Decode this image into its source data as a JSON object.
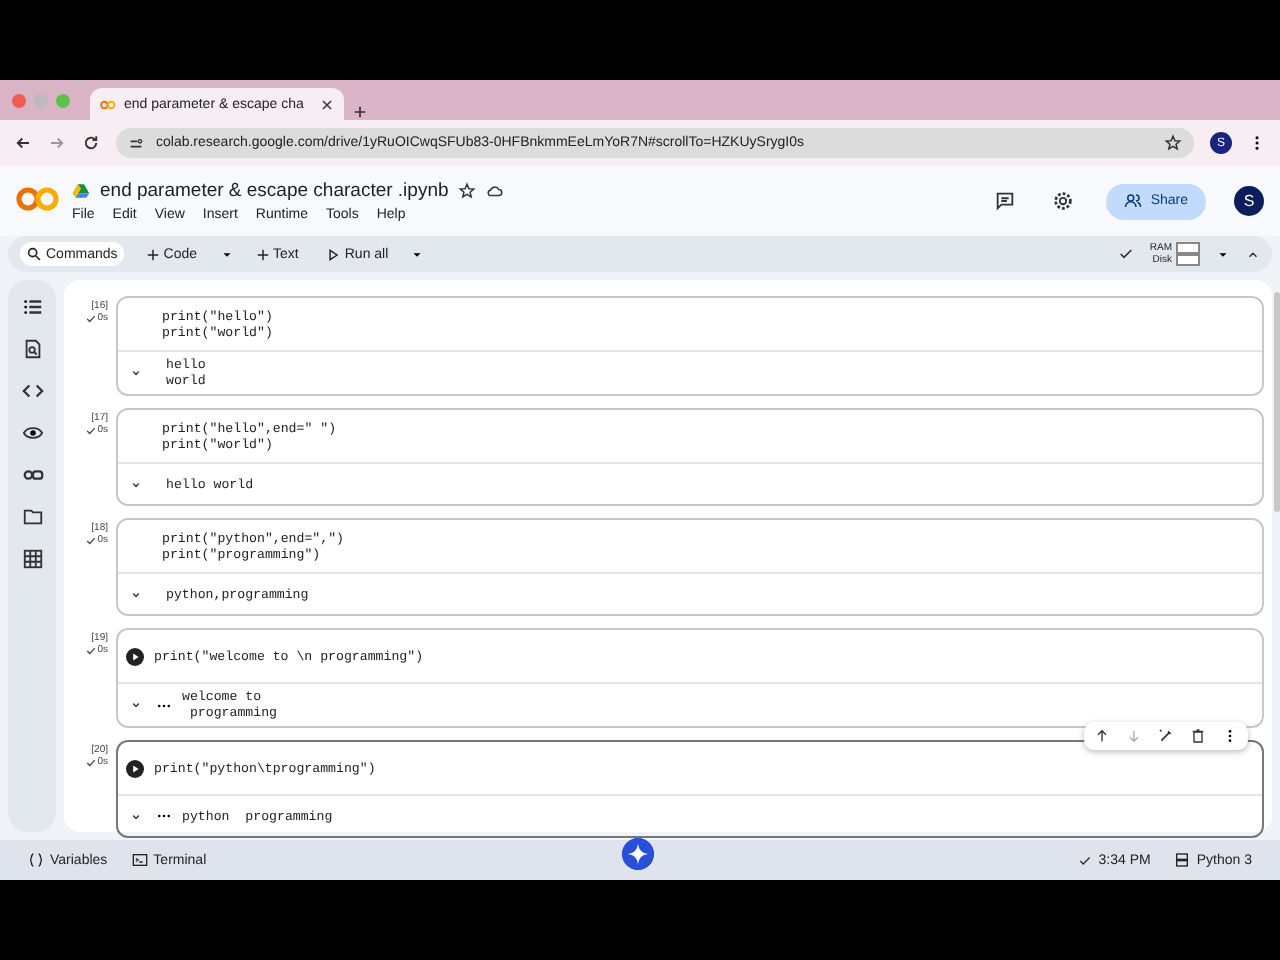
{
  "browser": {
    "tab_title": "end parameter & escape cha",
    "url": "colab.research.google.com/drive/1yRuOICwqSFUb83-0HFBnkmmEeLmYoR7N#scrollTo=HZKUySrygI0s",
    "profile": "S"
  },
  "notebook": {
    "title": "end parameter & escape character .ipynb",
    "menu": [
      "File",
      "Edit",
      "View",
      "Insert",
      "Runtime",
      "Tools",
      "Help"
    ],
    "share": "Share",
    "avatar": "S"
  },
  "toolbar": {
    "commands": "Commands",
    "code": "Code",
    "text": "Text",
    "run_all": "Run all",
    "ram": "RAM",
    "disk": "Disk"
  },
  "cells": [
    {
      "number": "[16]",
      "time": "0s",
      "hovered": false,
      "selected": false,
      "code": [
        "print(\"hello\")",
        "print(\"world\")"
      ],
      "output": [
        "hello",
        "world"
      ]
    },
    {
      "number": "[17]",
      "time": "0s",
      "hovered": false,
      "selected": false,
      "code": [
        "print(\"hello\",end=\" \")",
        "print(\"world\")"
      ],
      "output": [
        "hello world"
      ]
    },
    {
      "number": "[18]",
      "time": "0s",
      "hovered": false,
      "selected": false,
      "code": [
        "print(\"python\",end=\",\")",
        "print(\"programming\")"
      ],
      "output": [
        "python,programming"
      ]
    },
    {
      "number": "[19]",
      "time": "0s",
      "hovered": true,
      "selected": false,
      "code": [
        "print(\"welcome to \\n programming\")"
      ],
      "output": [
        "welcome to",
        " programming"
      ]
    },
    {
      "number": "[20]",
      "time": "0s",
      "hovered": true,
      "selected": true,
      "code": [
        "print(\"python\\tprogramming\")"
      ],
      "output": [
        "python  programming"
      ]
    }
  ],
  "status_bar": {
    "variables": "Variables",
    "terminal": "Terminal",
    "time": "3:34 PM",
    "runtime": "Python 3"
  }
}
